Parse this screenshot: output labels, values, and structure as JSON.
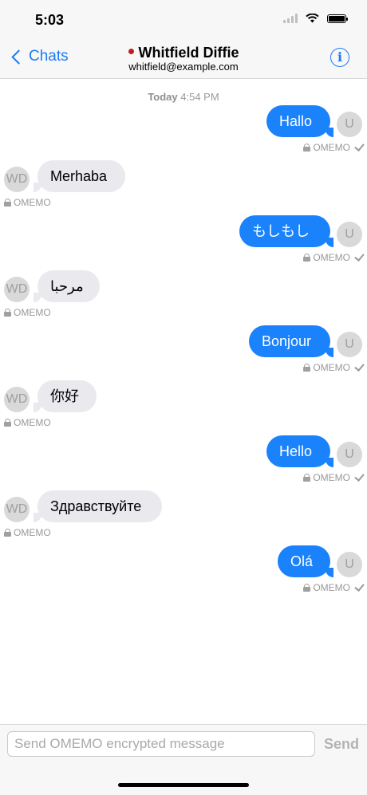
{
  "status": {
    "time": "5:03",
    "icons": [
      "signal-icon",
      "wifi-icon",
      "battery-icon"
    ]
  },
  "nav": {
    "back_label": "Chats",
    "contact_name": "Whitfield Diffie",
    "contact_jid": "whitfield@example.com",
    "presence_color": "#c21d1d",
    "info_icon": "info-icon"
  },
  "date_separator": {
    "day": "Today",
    "time": "4:54 PM"
  },
  "messages": [
    {
      "dir": "out",
      "text": "Hallo",
      "avatar": "U",
      "encryption": "OMEMO",
      "delivered": true
    },
    {
      "dir": "in",
      "text": "Merhaba",
      "avatar": "WD",
      "encryption": "OMEMO"
    },
    {
      "dir": "out",
      "text": "もしもし",
      "avatar": "U",
      "encryption": "OMEMO",
      "delivered": true
    },
    {
      "dir": "in",
      "text": "مرحبا",
      "avatar": "WD",
      "encryption": "OMEMO"
    },
    {
      "dir": "out",
      "text": "Bonjour",
      "avatar": "U",
      "encryption": "OMEMO",
      "delivered": true
    },
    {
      "dir": "in",
      "text": "你好",
      "avatar": "WD",
      "encryption": "OMEMO"
    },
    {
      "dir": "out",
      "text": "Hello",
      "avatar": "U",
      "encryption": "OMEMO",
      "delivered": true
    },
    {
      "dir": "in",
      "text": "Здравствуйте",
      "avatar": "WD",
      "encryption": "OMEMO"
    },
    {
      "dir": "out",
      "text": "Olá",
      "avatar": "U",
      "encryption": "OMEMO",
      "delivered": true
    }
  ],
  "composer": {
    "placeholder": "Send OMEMO encrypted message",
    "value": "",
    "send_label": "Send"
  },
  "colors": {
    "accent": "#1a7cf5",
    "outgoing_bubble": "#1a82fb",
    "incoming_bubble": "#e9e9ee"
  }
}
